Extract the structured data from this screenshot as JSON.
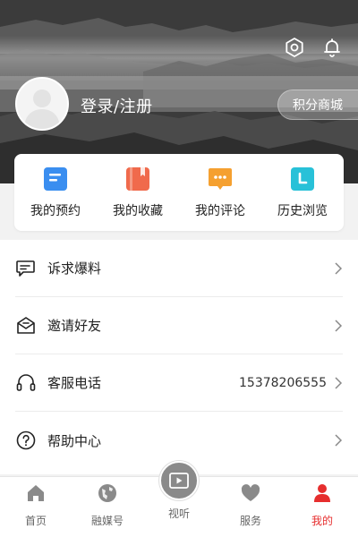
{
  "header": {
    "login_label": "登录/注册",
    "points_mall_label": "积分商城",
    "icons": [
      "settings-icon",
      "bell-icon"
    ]
  },
  "quick_actions": [
    {
      "label": "我的预约",
      "icon": "reservation-icon",
      "color": "#3a8ef0"
    },
    {
      "label": "我的收藏",
      "icon": "favorites-icon",
      "color": "#f06a4c"
    },
    {
      "label": "我的评论",
      "icon": "comment-icon",
      "color": "#f5a030"
    },
    {
      "label": "历史浏览",
      "icon": "history-icon",
      "color": "#28c1d8"
    }
  ],
  "menu": [
    {
      "label": "诉求爆料",
      "icon": "feedback-icon",
      "value": ""
    },
    {
      "label": "邀请好友",
      "icon": "invite-icon",
      "value": ""
    },
    {
      "label": "客服电话",
      "icon": "headset-icon",
      "value": "15378206555"
    },
    {
      "label": "帮助中心",
      "icon": "help-icon",
      "value": ""
    }
  ],
  "tabbar": {
    "home": "首页",
    "media": "融媒号",
    "video": "视听",
    "service": "服务",
    "mine": "我的",
    "active": "mine",
    "active_color": "#e62e2e"
  }
}
